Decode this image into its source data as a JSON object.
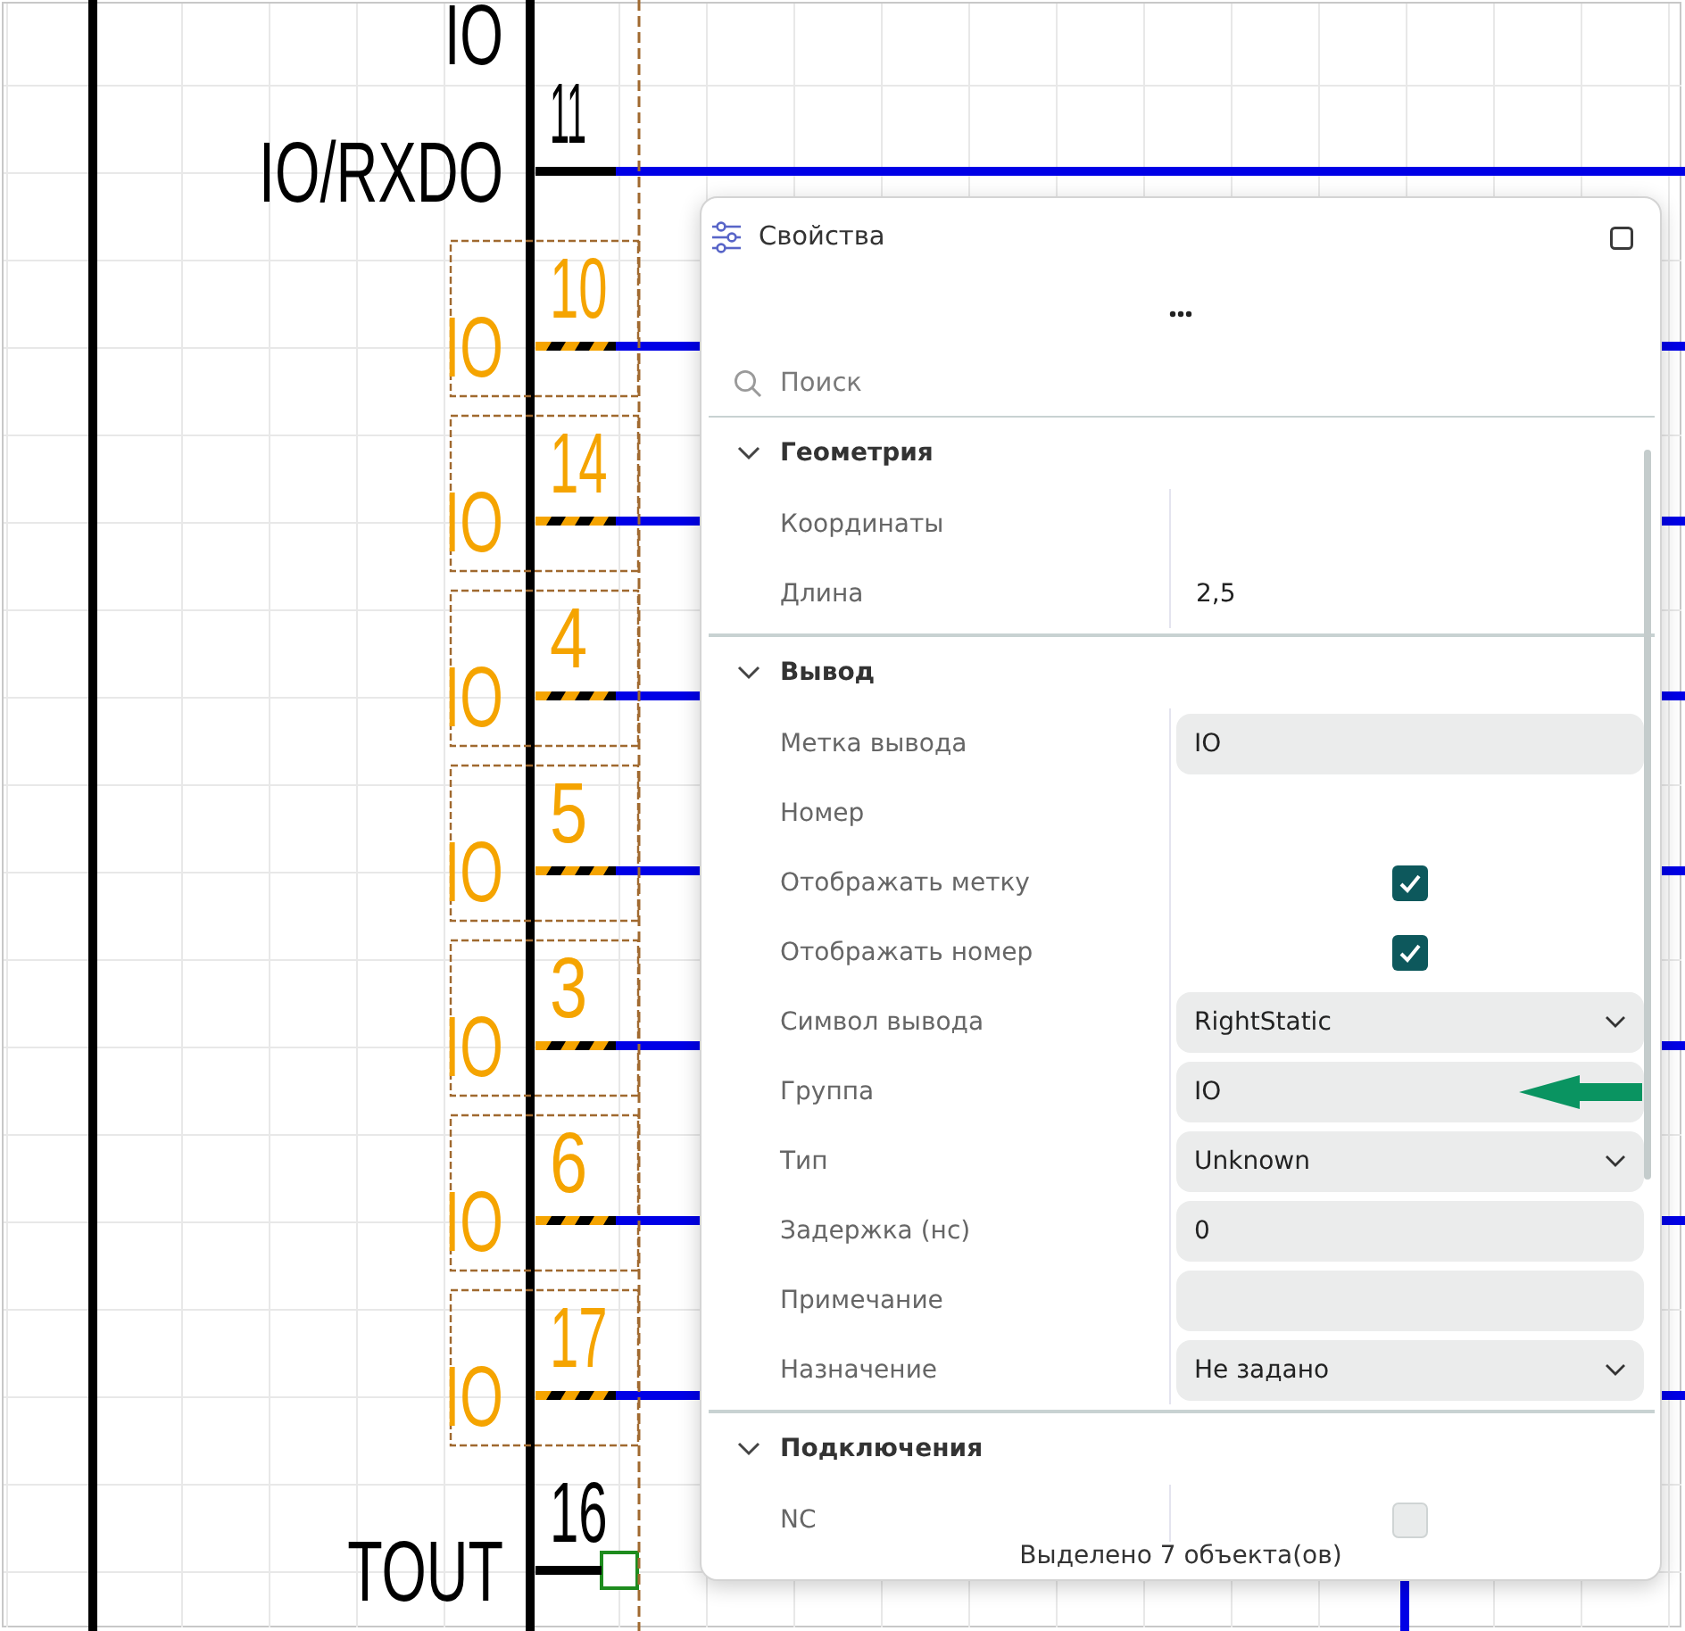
{
  "schematic": {
    "label_above": "IO",
    "pins": [
      {
        "number": "11",
        "label": "IO/RXDO",
        "selected": false,
        "kind": "wire"
      },
      {
        "number": "10",
        "label": "IO",
        "selected": true,
        "kind": "wire"
      },
      {
        "number": "14",
        "label": "IO",
        "selected": true,
        "kind": "wire"
      },
      {
        "number": "4",
        "label": "IO",
        "selected": true,
        "kind": "wire"
      },
      {
        "number": "5",
        "label": "IO",
        "selected": true,
        "kind": "wire"
      },
      {
        "number": "3",
        "label": "IO",
        "selected": true,
        "kind": "wire"
      },
      {
        "number": "6",
        "label": "IO",
        "selected": true,
        "kind": "wire"
      },
      {
        "number": "17",
        "label": "IO",
        "selected": true,
        "kind": "wire"
      },
      {
        "number": "16",
        "label": "TOUT",
        "selected": false,
        "kind": "open"
      }
    ]
  },
  "panel": {
    "title": "Свойства",
    "search": {
      "placeholder": "Поиск"
    },
    "sections": [
      {
        "title": "Геометрия",
        "expanded": true,
        "rows": [
          {
            "label": "Координаты",
            "kind": "plain",
            "arrow": false
          },
          {
            "label": "Длина",
            "kind": "plain",
            "value": "2,5",
            "arrow": false
          }
        ]
      },
      {
        "title": "Вывод",
        "expanded": true,
        "rows": [
          {
            "label": "Метка вывода",
            "kind": "input",
            "value": "IO",
            "arrow": false
          },
          {
            "label": "Номер",
            "kind": "plain",
            "arrow": false
          },
          {
            "label": "Отображать метку",
            "kind": "check",
            "checked": true,
            "arrow": false
          },
          {
            "label": "Отображать номер",
            "kind": "check",
            "checked": true,
            "arrow": false
          },
          {
            "label": "Символ вывода",
            "kind": "select",
            "value": "RightStatic",
            "arrow": false
          },
          {
            "label": "Группа",
            "kind": "input",
            "value": "IO",
            "arrow": true
          },
          {
            "label": "Тип",
            "kind": "select",
            "value": "Unknown",
            "arrow": false
          },
          {
            "label": "Задержка (нс)",
            "kind": "input",
            "value": "0",
            "arrow": false
          },
          {
            "label": "Примечание",
            "kind": "input",
            "arrow": false
          },
          {
            "label": "Назначение",
            "kind": "select",
            "value": "Не задано",
            "arrow": false
          }
        ]
      },
      {
        "title": "Подключения",
        "expanded": true,
        "rows": [
          {
            "label": "NC",
            "kind": "check",
            "checked": false,
            "arrow": false
          }
        ]
      }
    ],
    "status": "Выделено 7 объекта(ов)"
  }
}
